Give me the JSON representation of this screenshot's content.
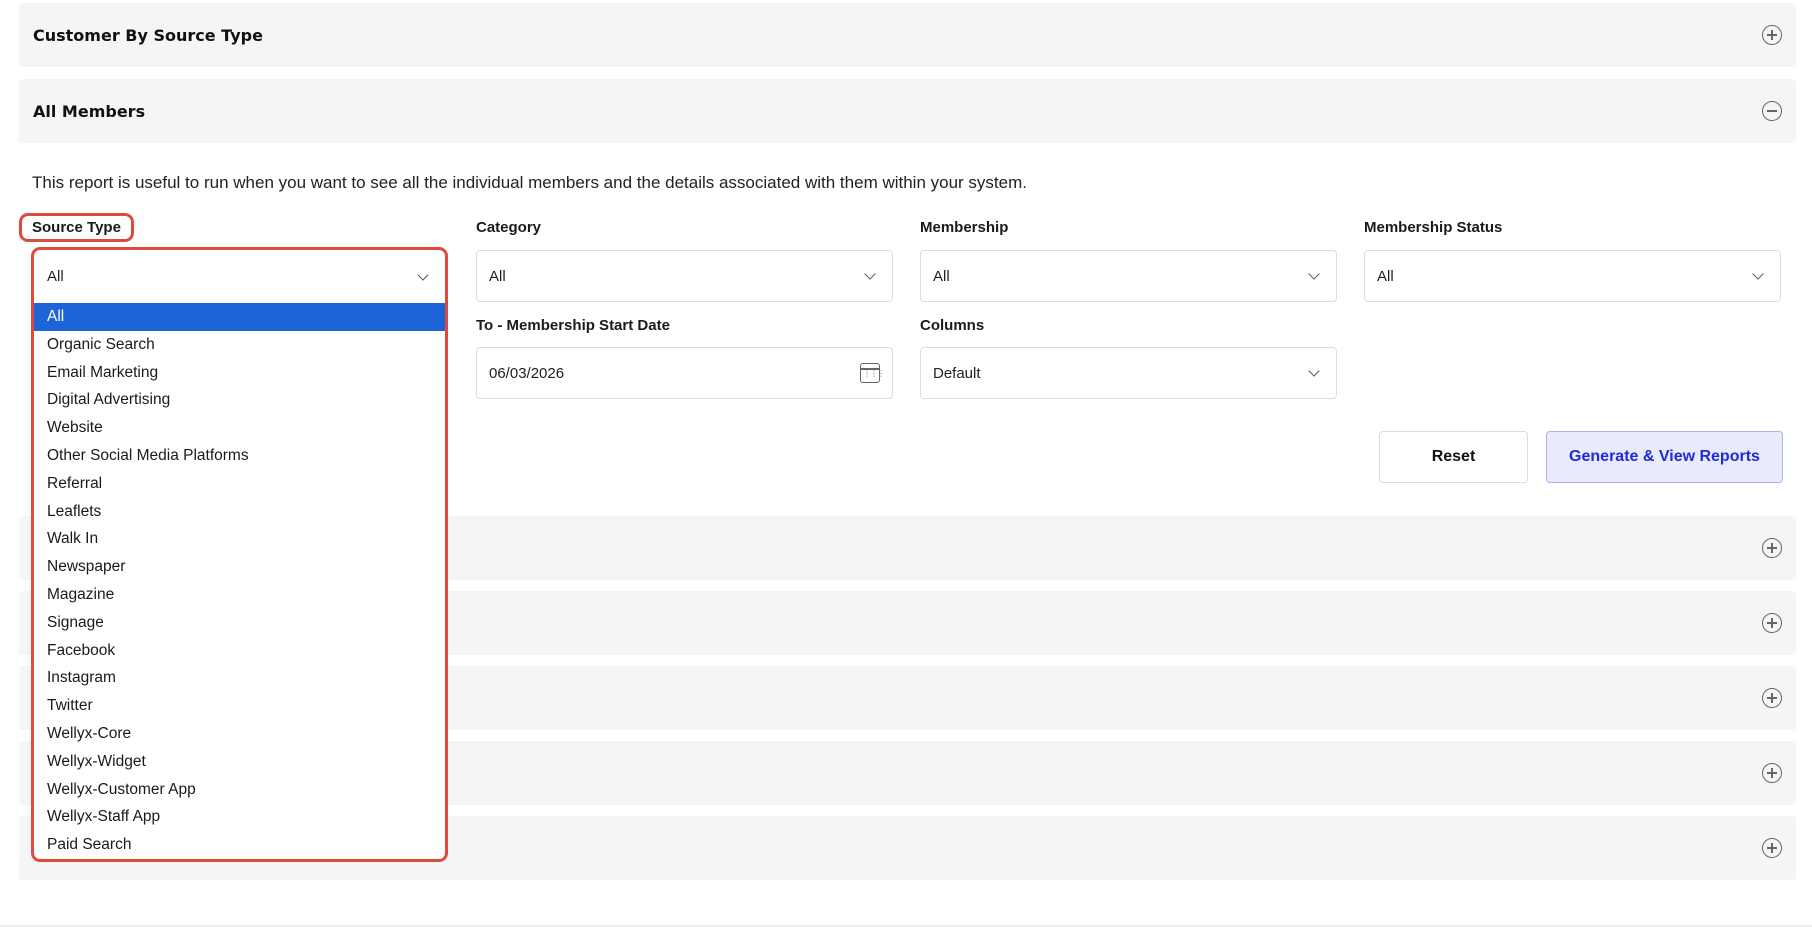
{
  "panels": {
    "customer_by_source": {
      "title": "Customer By Source Type"
    },
    "all_members": {
      "title": "All Members"
    }
  },
  "report": {
    "description": "This report is useful to run when you want to see all the individual members and the details associated with them within your system."
  },
  "filters": {
    "source_type": {
      "label": "Source Type",
      "value": "All",
      "options": [
        "All",
        "Organic Search",
        "Email Marketing",
        "Digital Advertising",
        "Website",
        "Other Social Media Platforms",
        "Referral",
        "Leaflets",
        "Walk In",
        "Newspaper",
        "Magazine",
        "Signage",
        "Facebook",
        "Instagram",
        "Twitter",
        "Wellyx-Core",
        "Wellyx-Widget",
        "Wellyx-Customer App",
        "Wellyx-Staff App",
        "Paid Search"
      ]
    },
    "category": {
      "label": "Category",
      "value": "All"
    },
    "membership": {
      "label": "Membership",
      "value": "All"
    },
    "membership_status": {
      "label": "Membership Status",
      "value": "All"
    },
    "to_membership_start_date": {
      "label": "To - Membership Start Date",
      "value": "06/03/2026"
    },
    "columns": {
      "label": "Columns",
      "value": "Default"
    }
  },
  "buttons": {
    "reset": "Reset",
    "generate": "Generate & View Reports"
  },
  "colors": {
    "highlight": "#dd4b3c",
    "selected_option": "#1c64d8",
    "generate_text": "#1f2bd6",
    "panel_bg": "#f4f5f7"
  }
}
